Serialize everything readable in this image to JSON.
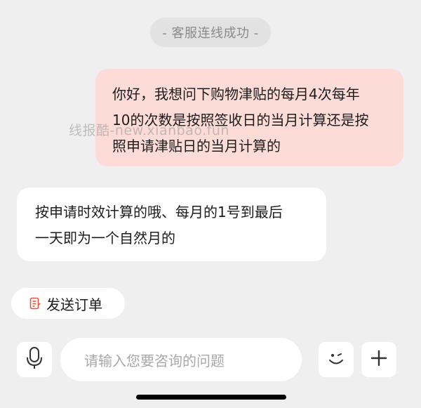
{
  "system_message": "- 客服连线成功 -",
  "messages": [
    {
      "role": "user",
      "text": "你好，我想问下购物津贴的每月4次每年\n10的次数是按照签收日的当月计算还是按\n照申请津贴日的当月计算的"
    },
    {
      "role": "agent",
      "text": "按申请时效计算的哦、每月的1号到最后\n一天即为一个自然月的"
    }
  ],
  "watermark": "线报酷-new.xianbao.fun",
  "quick_action": {
    "label": "发送订单",
    "icon": "order-icon"
  },
  "input_bar": {
    "placeholder": "请输入您要咨询的问题",
    "left_icon": "microphone-icon",
    "right_icons": [
      "emoji-icon",
      "plus-icon"
    ]
  },
  "colors": {
    "background": "#efefef",
    "user_bubble": "#fddcd8",
    "agent_bubble": "#ffffff",
    "accent": "#e8553e"
  }
}
